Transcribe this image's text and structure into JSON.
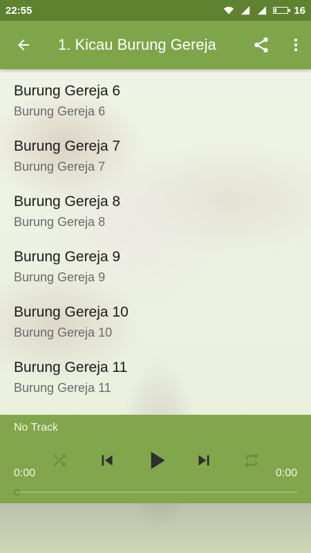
{
  "status_bar": {
    "time": "22:55",
    "battery_level": "16"
  },
  "app_bar": {
    "title": "1. Kicau Burung Gereja"
  },
  "tracks": [
    {
      "title": "Burung Gereja 6",
      "subtitle": "Burung Gereja 6"
    },
    {
      "title": "Burung Gereja 7",
      "subtitle": "Burung Gereja 7"
    },
    {
      "title": "Burung Gereja 8",
      "subtitle": "Burung Gereja 8"
    },
    {
      "title": "Burung Gereja 9",
      "subtitle": "Burung Gereja 9"
    },
    {
      "title": "Burung Gereja 10",
      "subtitle": "Burung Gereja 10"
    },
    {
      "title": "Burung Gereja 11",
      "subtitle": "Burung Gereja 11"
    }
  ],
  "player": {
    "track_name": "No Track",
    "elapsed": "0:00",
    "duration": "0:00",
    "progress": 0
  },
  "icons": [
    "back-arrow-icon",
    "share-icon",
    "more-vert-icon",
    "shuffle-icon",
    "skip-previous-icon",
    "play-icon",
    "skip-next-icon",
    "repeat-icon",
    "wifi-icon",
    "signal-icon",
    "battery-icon"
  ],
  "colors": {
    "status_bar": "#5f8230",
    "app_bar": "#7fa54a",
    "player": "#82a64b"
  }
}
